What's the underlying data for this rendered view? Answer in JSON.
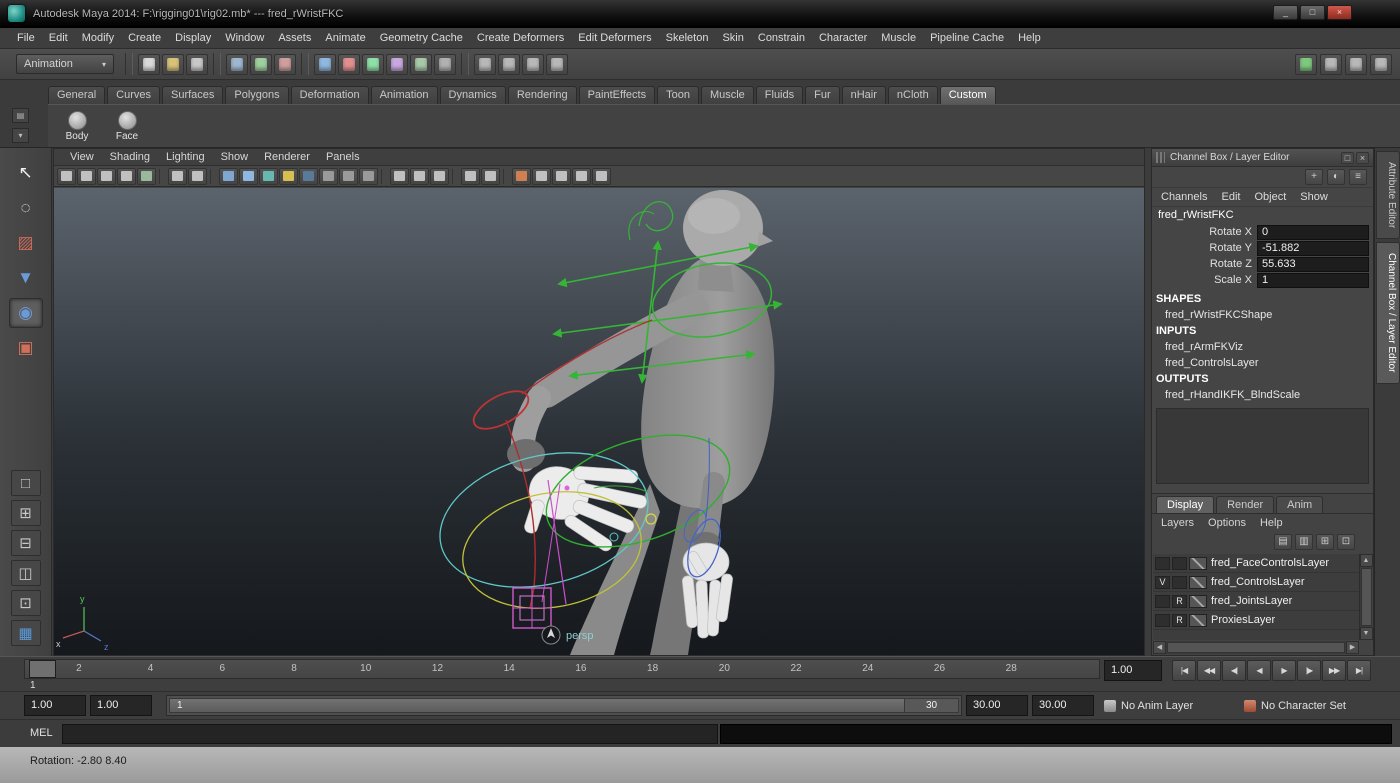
{
  "title_bar": {
    "title": "Autodesk Maya 2014: F:\\rigging01\\rig02.mb*  ---  fred_rWristFKC",
    "buttons": [
      {
        "name": "minimize-button",
        "glyph": "_"
      },
      {
        "name": "maximize-button",
        "glyph": "□"
      },
      {
        "name": "close-button",
        "glyph": "×",
        "cls": "close"
      }
    ]
  },
  "menu_bar": {
    "items": [
      "File",
      "Edit",
      "Modify",
      "Create",
      "Display",
      "Window",
      "Assets",
      "Animate",
      "Geometry Cache",
      "Create Deformers",
      "Edit Deformers",
      "Skeleton",
      "Skin",
      "Constrain",
      "Character",
      "Muscle",
      "Pipeline Cache",
      "Help"
    ]
  },
  "toolbar": {
    "menu_set": "Animation",
    "menu_set_caret": "▾",
    "file_icons": [
      {
        "name": "new-scene-icon",
        "color": "#d8d8d8"
      },
      {
        "name": "open-scene-icon",
        "color": "#d8c27a"
      },
      {
        "name": "save-scene-icon",
        "color": "#c8c8c8"
      }
    ],
    "selection_icons": [
      {
        "name": "select-hierarchy-icon",
        "color": "#9fb6cf"
      },
      {
        "name": "select-object-icon",
        "color": "#9fcf9f"
      },
      {
        "name": "select-component-icon",
        "color": "#cf9f9f"
      }
    ],
    "snap_icons": [
      {
        "name": "snap-to-grid-icon",
        "color": "#8fb8e0"
      },
      {
        "name": "snap-to-curve-icon",
        "color": "#e08f8f"
      },
      {
        "name": "snap-to-point-icon",
        "color": "#8fe0a8"
      },
      {
        "name": "snap-to-plane-icon",
        "color": "#c8a8e0"
      },
      {
        "name": "make-live-icon",
        "color": "#a8c8a8"
      },
      {
        "name": "snap-to-view-icon",
        "color": "#b0b0b0"
      }
    ],
    "render_icons": [
      {
        "name": "construction-history-icon",
        "color": "#b8b8b8"
      },
      {
        "name": "render-current-frame-icon",
        "color": "#b8b8b8"
      },
      {
        "name": "ipr-render-icon",
        "color": "#b8b8b8"
      },
      {
        "name": "render-settings-icon",
        "color": "#b8b8b8"
      }
    ],
    "right_icons": [
      {
        "name": "hypergraph-toggle-icon",
        "color": "#7fc87f"
      },
      {
        "name": "attribute-editor-toggle-icon",
        "color": "#b8b8b8"
      },
      {
        "name": "tool-settings-toggle-icon",
        "color": "#b8b8b8"
      },
      {
        "name": "channel-box-toggle-icon",
        "color": "#b8b8b8"
      }
    ]
  },
  "shelf": {
    "side_icons": [
      {
        "name": "shelf-tab-switcher-icon",
        "glyph": "▤"
      },
      {
        "name": "shelf-menu-icon",
        "glyph": "▾"
      }
    ],
    "tabs": [
      {
        "label": "General"
      },
      {
        "label": "Curves"
      },
      {
        "label": "Surfaces"
      },
      {
        "label": "Polygons"
      },
      {
        "label": "Deformation"
      },
      {
        "label": "Animation"
      },
      {
        "label": "Dynamics"
      },
      {
        "label": "Rendering"
      },
      {
        "label": "PaintEffects"
      },
      {
        "label": "Toon"
      },
      {
        "label": "Muscle"
      },
      {
        "label": "Fluids"
      },
      {
        "label": "Fur"
      },
      {
        "label": "nHair"
      },
      {
        "label": "nCloth"
      },
      {
        "label": "Custom",
        "active": true
      }
    ],
    "items": [
      {
        "label": "Body"
      },
      {
        "label": "Face"
      }
    ]
  },
  "toolbox": {
    "tools": [
      {
        "name": "select-tool-icon",
        "glyph": "↖",
        "color": "#f0f0f0"
      },
      {
        "name": "lasso-select-tool-icon",
        "glyph": "◌",
        "color": "#e0e0e0"
      },
      {
        "name": "paint-select-tool-icon",
        "glyph": "▨",
        "color": "#d06a5a"
      },
      {
        "name": "move-tool-icon",
        "glyph": "▼",
        "color": "#6a9ad8"
      },
      {
        "name": "rotate-tool-icon",
        "glyph": "◉",
        "color": "#6a9ad8",
        "active": true
      },
      {
        "name": "scale-tool-icon",
        "glyph": "▣",
        "color": "#d0705a"
      }
    ],
    "layouts": [
      {
        "name": "single-pane-layout-icon",
        "glyph": "□",
        "color": "#c8c8c8"
      },
      {
        "name": "four-pane-layout-icon",
        "glyph": "⊞",
        "color": "#c8c8c8"
      },
      {
        "name": "two-pane-layout-icon",
        "glyph": "⊟",
        "color": "#c8c8c8"
      },
      {
        "name": "outliner-persp-layout-icon",
        "glyph": "◫",
        "color": "#c8c8c8"
      },
      {
        "name": "hypershade-persp-layout-icon",
        "glyph": "⊡",
        "color": "#c8c8c8"
      },
      {
        "name": "persp-uv-layout-icon",
        "glyph": "▦",
        "color": "#5a9ad8"
      }
    ]
  },
  "viewport": {
    "menus": [
      "View",
      "Shading",
      "Lighting",
      "Show",
      "Renderer",
      "Panels"
    ],
    "toolbar_icons": [
      {
        "name": "select-camera-icon",
        "color": "#c0c0c0"
      },
      {
        "name": "lock-camera-icon",
        "color": "#c0c0c0"
      },
      {
        "name": "camera-attributes-icon",
        "color": "#c0c0c0"
      },
      {
        "name": "bookmarks-icon",
        "color": "#c0c0c0"
      },
      {
        "name": "image-plane-icon",
        "color": "#9ab89a"
      },
      {
        "cls": "sep",
        "name": "separator"
      },
      {
        "name": "2d-pan-zoom-icon",
        "color": "#c0c0c0"
      },
      {
        "name": "oversampling-icon",
        "color": "#c0c0c0"
      },
      {
        "cls": "sep",
        "name": "separator"
      },
      {
        "name": "wireframe-icon",
        "color": "#7fa8d0"
      },
      {
        "name": "shaded-icon",
        "color": "#8fb8e0"
      },
      {
        "name": "textured-icon",
        "color": "#66b8b0"
      },
      {
        "name": "use-all-lights-icon",
        "color": "#d8c050"
      },
      {
        "name": "shadows-icon",
        "color": "#5a7a9a"
      },
      {
        "name": "screen-ao-icon",
        "color": "#9a9a9a"
      },
      {
        "name": "motion-blur-icon",
        "color": "#9a9a9a"
      },
      {
        "name": "multisample-icon",
        "color": "#9a9a9a"
      },
      {
        "cls": "sep",
        "name": "separator"
      },
      {
        "name": "isolate-select-icon",
        "color": "#c0c0c0"
      },
      {
        "name": "xray-icon",
        "color": "#c0c0c0"
      },
      {
        "name": "xray-joints-icon",
        "color": "#c0c0c0"
      },
      {
        "cls": "sep",
        "name": "separator"
      },
      {
        "name": "exposure-icon",
        "color": "#c0c0c0"
      },
      {
        "name": "gamma-icon",
        "color": "#c0c0c0"
      },
      {
        "cls": "sep",
        "name": "separator"
      },
      {
        "name": "grease-pencil-icon",
        "color": "#d08050"
      },
      {
        "name": "snapshot-icon",
        "color": "#c0c0c0"
      },
      {
        "name": "cube-views-icon",
        "color": "#c0c0c0"
      },
      {
        "name": "panel-layouts-icon",
        "color": "#c0c0c0"
      },
      {
        "name": "share-icon",
        "color": "#c0c0c0"
      }
    ],
    "camera_label": "persp",
    "axis": {
      "x": "x",
      "y": "y",
      "z": "z"
    }
  },
  "channel_box": {
    "panel_title": "Channel Box / Layer Editor",
    "header_icons": [
      {
        "name": "popout-icon",
        "glyph": "□"
      },
      {
        "name": "close-icon",
        "glyph": "×"
      }
    ],
    "tool_icons": [
      {
        "name": "show-manipulators-icon",
        "glyph": "+"
      },
      {
        "name": "speed-state-icon",
        "glyph": "◐"
      },
      {
        "name": "edit-channels-icon",
        "glyph": "≡"
      }
    ],
    "menus": [
      "Channels",
      "Edit",
      "Object",
      "Show"
    ],
    "object_name": "fred_rWristFKC",
    "channels": [
      {
        "label": "Rotate X",
        "value": "0"
      },
      {
        "label": "Rotate Y",
        "value": "-51.882"
      },
      {
        "label": "Rotate Z",
        "value": "55.633"
      },
      {
        "label": "Scale X",
        "value": "1"
      }
    ],
    "rows": [
      {
        "type": "header",
        "text": "SHAPES"
      },
      {
        "type": "item",
        "text": "fred_rWristFKCShape"
      },
      {
        "type": "header",
        "text": "INPUTS"
      },
      {
        "type": "item",
        "text": "fred_rArmFKViz"
      },
      {
        "type": "item",
        "text": "fred_ControlsLayer"
      },
      {
        "type": "header",
        "text": "OUTPUTS"
      },
      {
        "type": "item",
        "text": "fred_rHandIKFK_BlndScale"
      }
    ]
  },
  "layer_editor": {
    "tabs": [
      {
        "label": "Display",
        "active": true
      },
      {
        "label": "Render"
      },
      {
        "label": "Anim"
      }
    ],
    "menus": [
      "Layers",
      "Options",
      "Help"
    ],
    "tool_icons": [
      {
        "name": "layer-sort-icon",
        "glyph": "▤"
      },
      {
        "name": "layer-stack-icon",
        "glyph": "▥"
      },
      {
        "name": "new-empty-layer-icon",
        "glyph": "⊞"
      },
      {
        "name": "new-layer-from-selected-icon",
        "glyph": "⊡"
      }
    ],
    "layers": [
      {
        "vis": "",
        "type": "",
        "name": "fred_FaceControlsLayer"
      },
      {
        "vis": "V",
        "type": "",
        "name": "fred_ControlsLayer"
      },
      {
        "vis": "",
        "type": "R",
        "name": "fred_JointsLayer"
      },
      {
        "vis": "",
        "type": "R",
        "name": "ProxiesLayer"
      }
    ]
  },
  "side_tabs": [
    {
      "label": "Attribute Editor"
    },
    {
      "label": "Channel Box / Layer Editor",
      "active": true
    }
  ],
  "timeline": {
    "ticks": [
      "2",
      "4",
      "6",
      "8",
      "10",
      "12",
      "14",
      "16",
      "18",
      "20",
      "22",
      "24",
      "26",
      "28"
    ],
    "current_frame": "1",
    "current_time": "1.00",
    "playback": [
      {
        "name": "go-to-start-button",
        "glyph": "|◀"
      },
      {
        "name": "step-back-frame-button",
        "glyph": "◀◀"
      },
      {
        "name": "step-back-key-button",
        "glyph": "◀|"
      },
      {
        "name": "play-backwards-button",
        "glyph": "◀"
      },
      {
        "name": "play-forwards-button",
        "glyph": "▶"
      },
      {
        "name": "step-forward-key-button",
        "glyph": "|▶"
      },
      {
        "name": "step-forward-frame-button",
        "glyph": "▶▶"
      },
      {
        "name": "go-to-end-button",
        "glyph": "▶|"
      }
    ]
  },
  "range_slider": {
    "anim_start": "1.00",
    "playback_start": "1.00",
    "range_start": "1",
    "range_end": "30",
    "playback_end": "30.00",
    "anim_end": "30.00",
    "anim_layer": "No Anim Layer",
    "character_set": "No Character Set"
  },
  "command_line": {
    "label": "MEL"
  },
  "help_line": {
    "text": "Rotation:  -2.80    8.40"
  }
}
